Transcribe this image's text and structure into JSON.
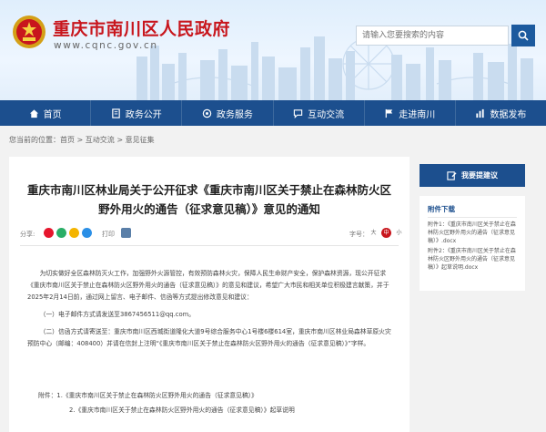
{
  "site": {
    "title": "重庆市南川区人民政府",
    "url": "www.cqnc.gov.cn"
  },
  "search": {
    "placeholder": "请输入您要搜索的内容"
  },
  "nav": [
    {
      "label": "首页",
      "icon": "home-icon"
    },
    {
      "label": "政务公开",
      "icon": "document-icon"
    },
    {
      "label": "政务服务",
      "icon": "service-icon"
    },
    {
      "label": "互动交流",
      "icon": "chat-icon"
    },
    {
      "label": "走进南川",
      "icon": "flag-icon"
    },
    {
      "label": "数据发布",
      "icon": "chart-icon"
    }
  ],
  "breadcrumb": "您当前的位置：首页 > 互动交流 > 意见征集",
  "article": {
    "title": "重庆市南川区林业局关于公开征求《重庆市南川区关于禁止在森林防火区野外用火的通告（征求意见稿）》意见的通知",
    "share_label": "分享:",
    "print_label": "打印",
    "size_label": "字号：",
    "size_options": [
      "大",
      "中",
      "小"
    ],
    "paragraphs": [
      "为切实做好全区森林防灭火工作，加强野外火源管控，有效预防森林火灾，保障人民生命财产安全，保护森林资源，现公开征求《重庆市南川区关于禁止在森林防火区野外用火的通告（征求意见稿）》的意见和建议，希望广大市民和相关单位积极建言献策，并于2025年2月14日前，通过网上留言、电子邮件、信函等方式提出修改意见和建议：",
      "（一）电子邮件方式请发送至3867456511@qq.com。",
      "（二）信函方式请寄送至：重庆市南川区西城街道隆化大道9号综合服务中心1号楼6楼614室，重庆市南川区林业局森林草原火灾预防中心（邮编：408400）并请在信封上注明“《重庆市南川区关于禁止在森林防火区野外用火的通告（征求意见稿）》”字样。"
    ],
    "attachments_label": "附件：",
    "attachments": [
      "1.《重庆市南川区关于禁止在森林防火区野外用火的通告（征求意见稿）》",
      "2.《重庆市南川区关于禁止在森林防火区野外用火的通告（征求意见稿）》起草说明"
    ]
  },
  "sidebar": {
    "button_label": "我要提建议",
    "download_title": "附件下载",
    "downloads": [
      "附件1：《重庆市南川区关于禁止在森林防火区野外用火的通告（征求意见稿）》.docx",
      "附件2：《重庆市南川区关于禁止在森林防火区野外用火的通告（征求意见稿）》起草说明.docx"
    ]
  },
  "colors": {
    "brand_red": "#c8161d",
    "nav_blue": "#1c4f8e"
  }
}
